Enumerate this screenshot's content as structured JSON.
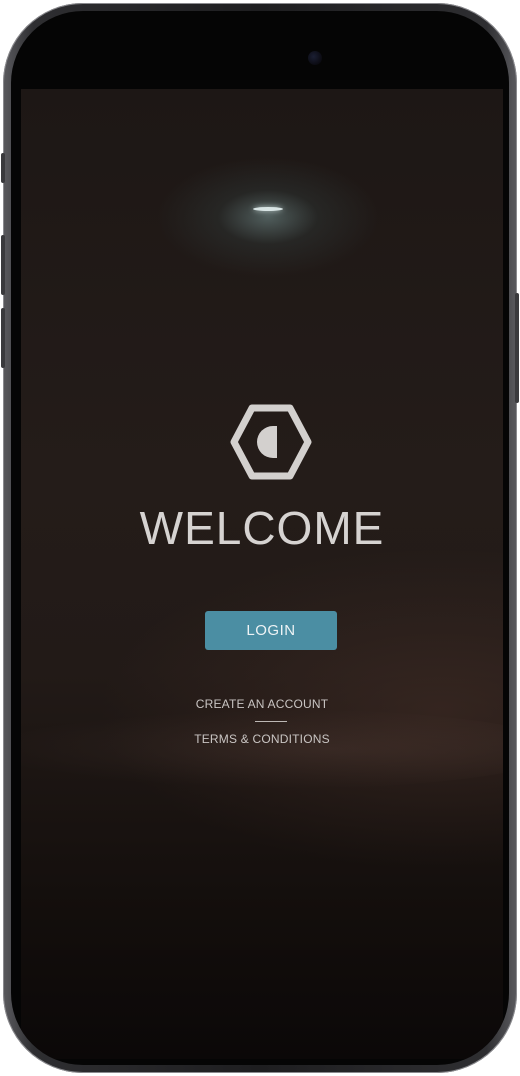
{
  "welcome": {
    "title": "WELCOME",
    "login_label": "LOGIN",
    "create_account_label": "CREATE AN ACCOUNT",
    "terms_label": "TERMS & CONDITIONS"
  },
  "logo": {
    "icon": "hexagon-half-circle-logo-icon"
  },
  "colors": {
    "accent": "#4b8ea3",
    "background": "#221a17",
    "text": "#d6d3d1"
  }
}
